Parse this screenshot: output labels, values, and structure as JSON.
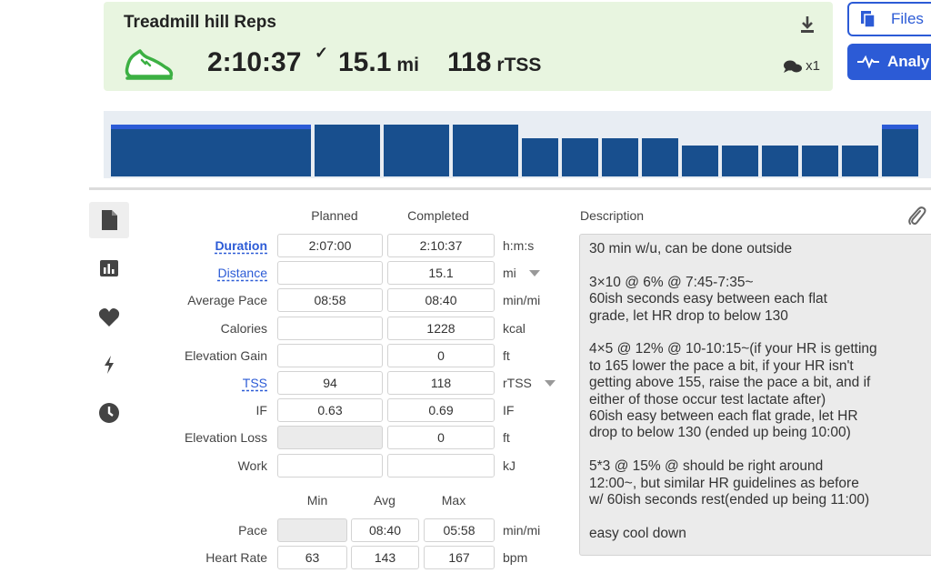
{
  "workout": {
    "title": "Treadmill hill Reps",
    "duration": "2:10:37",
    "distance_value": "15.1",
    "distance_unit": "mi",
    "tss_value": "118",
    "tss_unit": "rTSS",
    "comment_count": "x1",
    "sport_icon": "running-shoe-icon",
    "accent_green": "#3cb043"
  },
  "buttons": {
    "files_label": "Files",
    "analyze_label": "Analy",
    "accent": "#2c5bd6"
  },
  "interval_chart": {
    "bar_color": "#184f8e",
    "highlight_color": "#2c5bd6",
    "intervals": [
      {
        "relative_intensity": 0.68,
        "selected": true
      },
      {
        "relative_intensity": 0.68,
        "selected": false
      },
      {
        "relative_intensity": 0.68,
        "selected": false
      },
      {
        "relative_intensity": 0.68,
        "selected": false
      },
      {
        "relative_intensity": 0.5,
        "selected": false
      },
      {
        "relative_intensity": 0.5,
        "selected": false
      },
      {
        "relative_intensity": 0.5,
        "selected": false
      },
      {
        "relative_intensity": 0.5,
        "selected": false
      },
      {
        "relative_intensity": 0.41,
        "selected": false
      },
      {
        "relative_intensity": 0.41,
        "selected": false
      },
      {
        "relative_intensity": 0.41,
        "selected": false
      },
      {
        "relative_intensity": 0.41,
        "selected": false
      },
      {
        "relative_intensity": 0.41,
        "selected": false
      },
      {
        "relative_intensity": 0.68,
        "selected": true
      }
    ]
  },
  "side_nav": [
    {
      "name": "document-icon",
      "active": true
    },
    {
      "name": "bar-chart-icon",
      "active": false
    },
    {
      "name": "heart-icon",
      "active": false
    },
    {
      "name": "lightning-icon",
      "active": false
    },
    {
      "name": "clock-icon",
      "active": false
    }
  ],
  "summary": {
    "col_planned": "Planned",
    "col_completed": "Completed",
    "rows": [
      {
        "label": "Duration",
        "planned": "2:07:00",
        "completed": "2:10:37",
        "unit": "h:m:s",
        "link": true,
        "bold": true
      },
      {
        "label": "Distance",
        "planned": "",
        "completed": "15.1",
        "unit": "mi",
        "link": true,
        "dropdown": true
      },
      {
        "label": "Average Pace",
        "planned": "08:58",
        "completed": "08:40",
        "unit": "min/mi"
      },
      {
        "label": "Calories",
        "planned": "",
        "completed": "1228",
        "unit": "kcal"
      },
      {
        "label": "Elevation Gain",
        "planned": "",
        "completed": "0",
        "unit": "ft"
      },
      {
        "label": "TSS",
        "planned": "94",
        "completed": "118",
        "unit": "rTSS",
        "link": true,
        "dropdown": true
      },
      {
        "label": "IF",
        "planned": "0.63",
        "completed": "0.69",
        "unit": "IF"
      },
      {
        "label": "Elevation Loss",
        "planned": "",
        "completed": "0",
        "unit": "ft",
        "planned_disabled": true
      },
      {
        "label": "Work",
        "planned": "",
        "completed": "",
        "unit": "kJ"
      }
    ]
  },
  "stats": {
    "col_min": "Min",
    "col_avg": "Avg",
    "col_max": "Max",
    "rows": [
      {
        "label": "Pace",
        "min": "",
        "avg": "08:40",
        "max": "05:58",
        "unit": "min/mi",
        "min_disabled": true
      },
      {
        "label": "Heart Rate",
        "min": "63",
        "avg": "143",
        "max": "167",
        "unit": "bpm"
      }
    ]
  },
  "description": {
    "label": "Description",
    "text": "30 min w/u, can be done outside\n\n3×10 @ 6% @ 7:45-7:35~\n60ish seconds easy between each flat\ngrade, let HR drop to below 130\n\n4×5 @ 12% @ 10-10:15~(if your HR is getting\nto 165 lower the pace a bit, if your HR isn't\ngetting above 155, raise the pace a bit, and if\neither of those occur test lactate after)\n60ish easy between each flat grade, let HR\ndrop to below 130 (ended up being 10:00)\n\n5*3 @ 15% @ should be right around\n12:00~, but similar HR guidelines as before\nw/ 60ish seconds rest(ended up being 11:00)\n\neasy cool down"
  }
}
